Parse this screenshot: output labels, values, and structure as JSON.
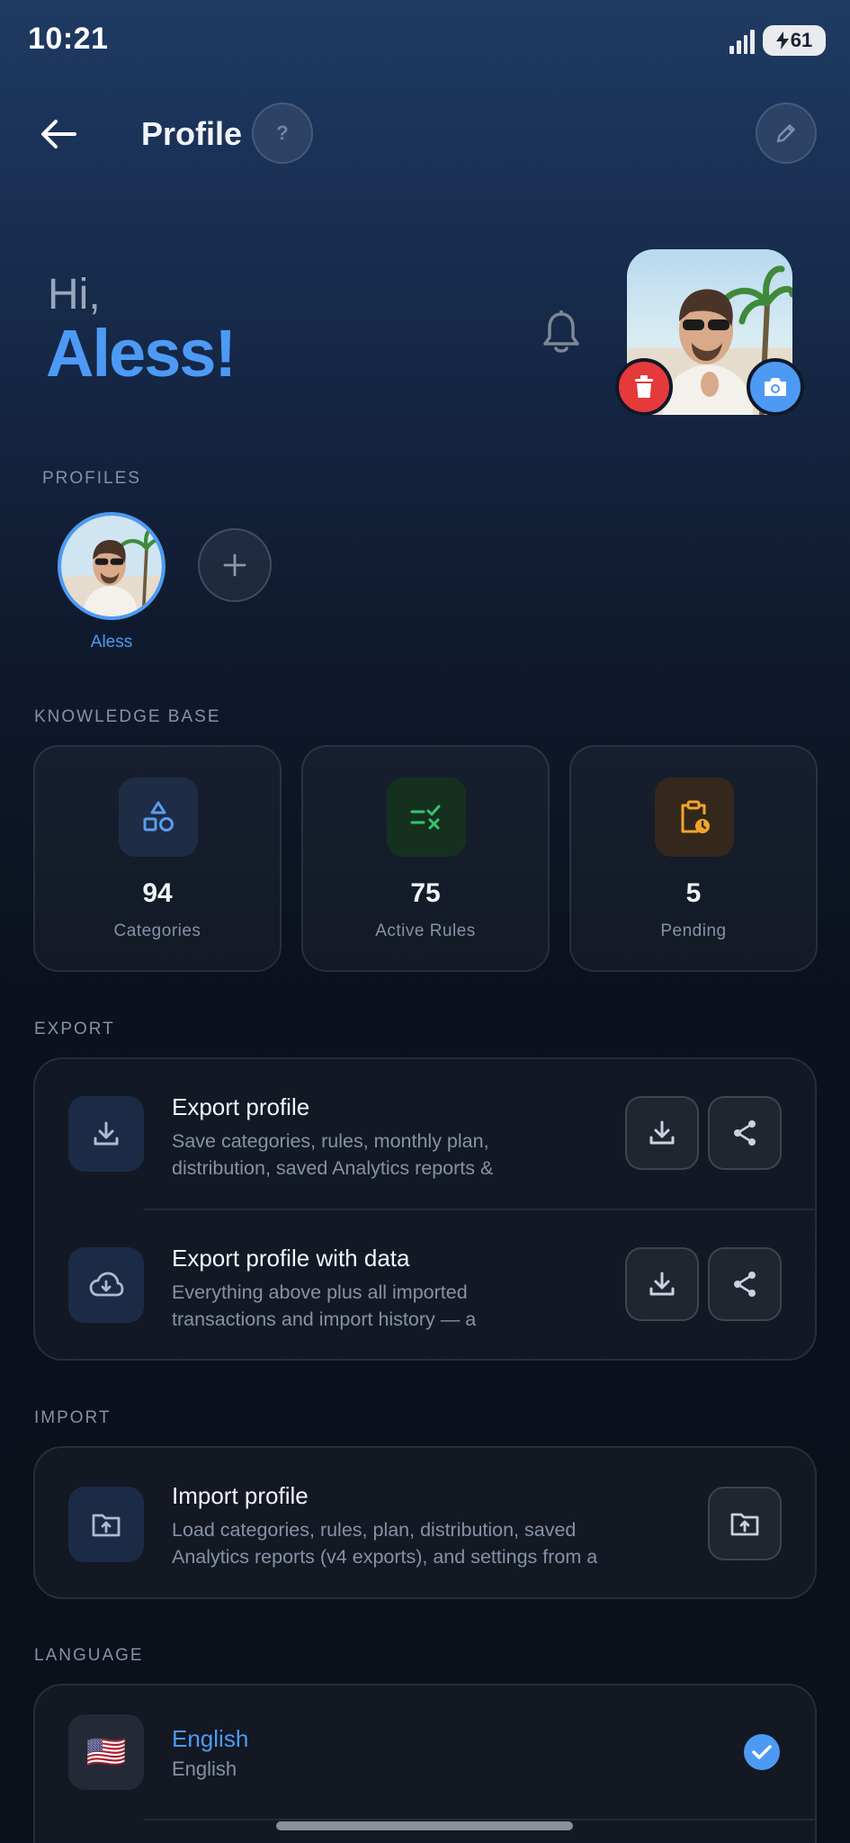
{
  "status_bar": {
    "time": "10:21",
    "battery": "61"
  },
  "header": {
    "title": "Profile",
    "help_label": "?"
  },
  "greeting": {
    "hi": "Hi,",
    "name": "Aless!"
  },
  "profiles": {
    "section_label": "PROFILES",
    "items": [
      {
        "name": "Aless"
      }
    ]
  },
  "knowledge_base": {
    "section_label": "KNOWLEDGE BASE",
    "stats": [
      {
        "value": "94",
        "label": "Categories",
        "icon": "shapes-icon",
        "color": "#5b9cf0"
      },
      {
        "value": "75",
        "label": "Active Rules",
        "icon": "rules-check-icon",
        "color": "#35c46e"
      },
      {
        "value": "5",
        "label": "Pending",
        "icon": "clipboard-clock-icon",
        "color": "#f2a52b"
      }
    ]
  },
  "export": {
    "section_label": "EXPORT",
    "rows": [
      {
        "title": "Export profile",
        "desc_line1": "Save categories, rules, monthly plan,",
        "desc_line2": "distribution, saved Analytics reports &"
      },
      {
        "title": "Export profile with data",
        "desc_line1": "Everything above plus all imported",
        "desc_line2": "transactions and import history — a"
      }
    ]
  },
  "import": {
    "section_label": "IMPORT",
    "title": "Import profile",
    "desc_line1": "Load categories, rules, plan, distribution, saved",
    "desc_line2": "Analytics reports (v4 exports), and settings from a"
  },
  "language": {
    "section_label": "LANGUAGE",
    "selected": {
      "name": "English",
      "native": "English",
      "flag": "🇺🇸"
    }
  },
  "colors": {
    "accent": "#4d9af5",
    "danger": "#e5393b"
  }
}
